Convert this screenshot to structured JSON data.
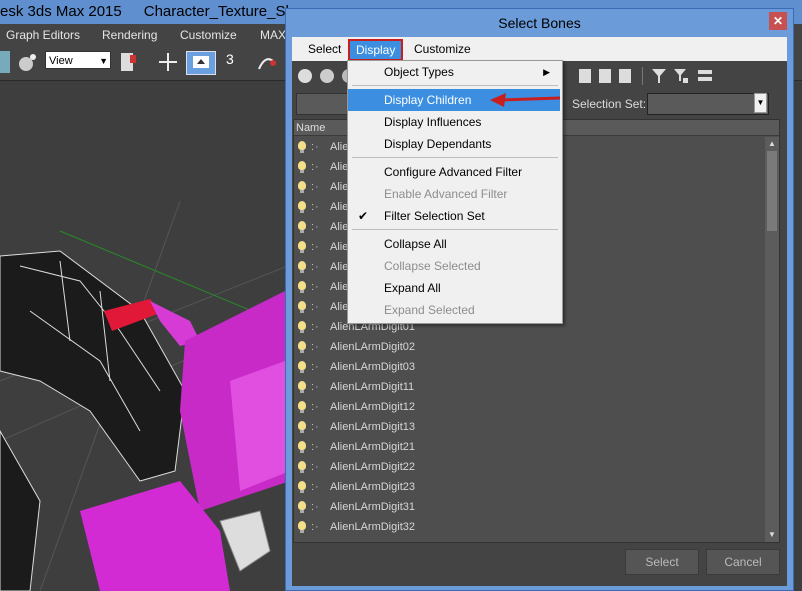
{
  "app": {
    "title": "esk 3ds Max  2015",
    "file": "Character_Texture_She",
    "menu": [
      "Graph Editors",
      "Rendering",
      "Customize",
      "MAX"
    ],
    "view_select": "View",
    "snap_label": "3"
  },
  "dialog": {
    "title": "Select Bones",
    "close": "✕",
    "menu": [
      "Select",
      "Display",
      "Customize"
    ],
    "selection_set_label": "Selection Set:",
    "list_header": "Name",
    "rows": [
      "Alien",
      "Alien",
      "Alien",
      "Alien",
      "Alien",
      "Alien",
      "Alien",
      "Alien",
      "Alien",
      "AlienLArmDigit01",
      "AlienLArmDigit02",
      "AlienLArmDigit03",
      "AlienLArmDigit11",
      "AlienLArmDigit12",
      "AlienLArmDigit13",
      "AlienLArmDigit21",
      "AlienLArmDigit22",
      "AlienLArmDigit23",
      "AlienLArmDigit31",
      "AlienLArmDigit32"
    ],
    "select_button": "Select",
    "cancel_button": "Cancel"
  },
  "dropdown": {
    "items": [
      {
        "label": "Object Types"
      },
      {
        "label": "Display Children"
      },
      {
        "label": "Display Influences"
      },
      {
        "label": "Display Dependants"
      },
      {
        "label": "Configure Advanced Filter"
      },
      {
        "label": "Enable Advanced Filter"
      },
      {
        "label": "Filter Selection Set"
      },
      {
        "label": "Collapse All"
      },
      {
        "label": "Collapse Selected"
      },
      {
        "label": "Expand All"
      },
      {
        "label": "Expand Selected"
      }
    ],
    "submenu_arrow": "▶",
    "check": "✔"
  },
  "colors": {
    "highlight": "#3b8ee0",
    "annotation": "#c81e1e"
  }
}
